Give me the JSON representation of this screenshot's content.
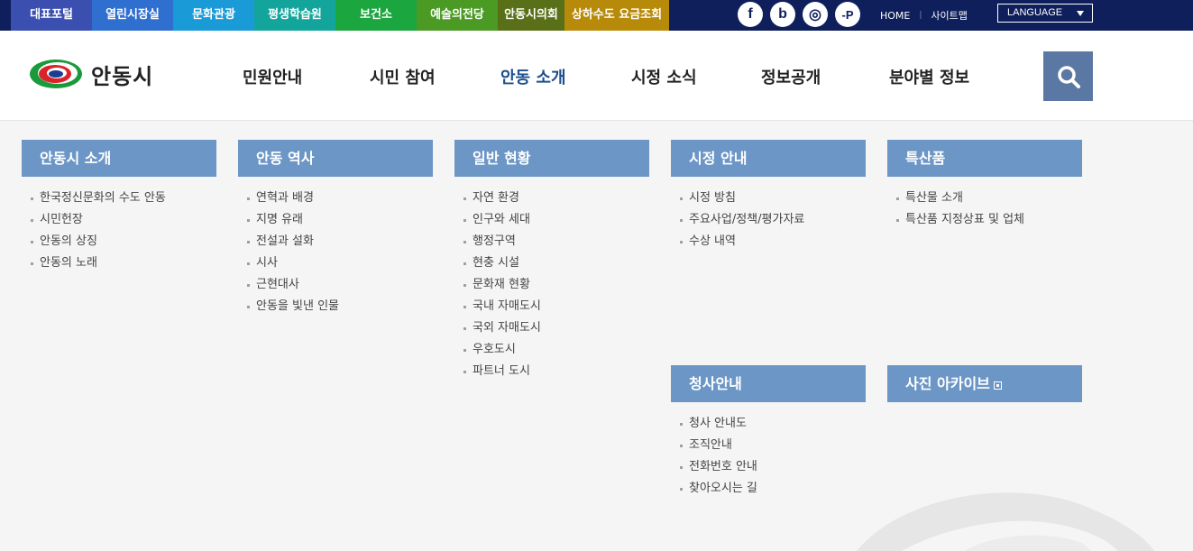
{
  "topbar": {
    "quick_links": [
      {
        "label": "대표포털",
        "color": "#3a4fb0",
        "width": 90
      },
      {
        "label": "열린시장실",
        "color": "#2f6fd0",
        "width": 90
      },
      {
        "label": "문화관광",
        "color": "#1a9ad6",
        "width": 90
      },
      {
        "label": "평생학습원",
        "color": "#13a59c",
        "width": 90
      },
      {
        "label": "보건소",
        "color": "#1ca63f",
        "width": 90
      },
      {
        "label": "예술의전당",
        "color": "#4a9a24",
        "width": 90
      },
      {
        "label": "안동시의회",
        "color": "#5a7018",
        "width": 74
      },
      {
        "label": "상하수도 요금조회",
        "color": "#b88a0a",
        "width": 116
      }
    ],
    "social": [
      "f",
      "b",
      "◎",
      "-P"
    ],
    "home": "HOME",
    "sitemap": "사이트맵",
    "language": "LANGUAGE"
  },
  "header": {
    "logo_text": "안동시",
    "nav": [
      {
        "label": "민원안내",
        "active": false
      },
      {
        "label": "시민 참여",
        "active": false
      },
      {
        "label": "안동 소개",
        "active": true
      },
      {
        "label": "시정 소식",
        "active": false
      },
      {
        "label": "정보공개",
        "active": false
      },
      {
        "label": "분야별 정보",
        "active": false
      }
    ]
  },
  "menu": {
    "col1": {
      "title": "안동시 소개",
      "items": [
        "한국정신문화의 수도 안동",
        "시민헌장",
        "안동의 상징",
        "안동의 노래"
      ]
    },
    "col2": {
      "title": "안동 역사",
      "items": [
        "연혁과 배경",
        "지명 유래",
        "전설과 설화",
        "시사",
        "근현대사",
        "안동을 빛낸 인물"
      ]
    },
    "col3": {
      "title": "일반 현황",
      "items": [
        "자연 환경",
        "인구와 세대",
        "행정구역",
        "현충 시설",
        "문화재 현황",
        "국내 자매도시",
        "국외 자매도시",
        "우호도시",
        "파트너 도시"
      ]
    },
    "col4": {
      "title": "시정 안내",
      "items": [
        "시정 방침",
        "주요사업/정책/평가자료",
        "수상 내역"
      ]
    },
    "col5": {
      "title": "특산품",
      "items": [
        "특산물 소개",
        "특산품 지정상표 및 업체"
      ]
    },
    "col6": {
      "title": "청사안내",
      "items": [
        "청사 안내도",
        "조직안내",
        "전화번호 안내",
        "찾아오시는 길"
      ]
    },
    "col7": {
      "title": "사진 아카이브",
      "items": []
    }
  }
}
